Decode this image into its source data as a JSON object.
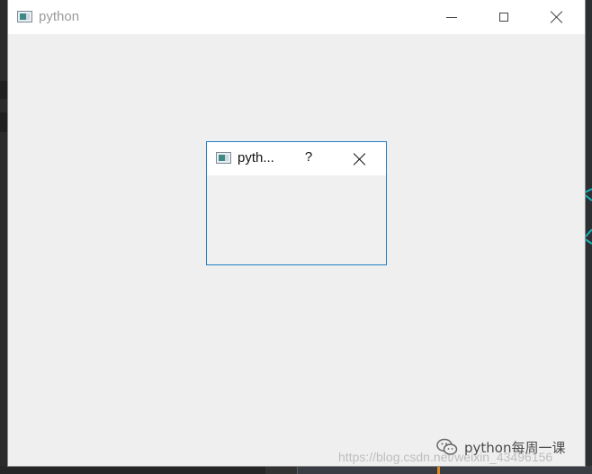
{
  "main_window": {
    "title": "python",
    "controls": {
      "minimize_icon": "minimize-icon",
      "maximize_icon": "maximize-icon",
      "close_icon": "close-icon"
    }
  },
  "dialog": {
    "title": "pyth...",
    "help_label": "?",
    "close_icon": "close-icon",
    "border_color": "#1f7fc5"
  },
  "watermark": {
    "brand": "python每周一课",
    "url": "https://blog.csdn.net/weixin_43496156"
  },
  "colors": {
    "window_bg": "#efefef",
    "titlebar_bg": "#ffffff",
    "accent": "#1f7fc5"
  }
}
